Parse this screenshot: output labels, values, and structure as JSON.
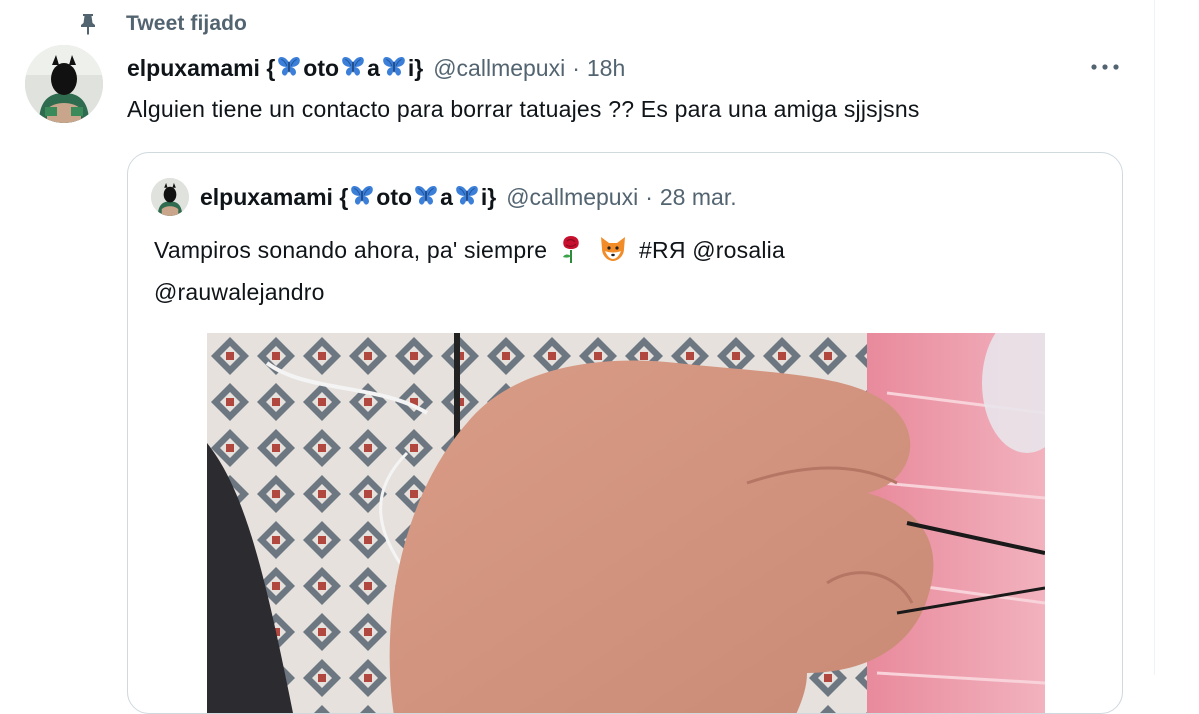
{
  "pinned": {
    "label": "Tweet fijado",
    "icon": "pin-icon"
  },
  "tweet": {
    "author": {
      "name_parts": [
        "elpuxamami {",
        "oto",
        "a",
        "i}"
      ],
      "handle": "@callmepuxi",
      "separator": "·",
      "time": "18h"
    },
    "text": "Alguien tiene un contacto para borrar tatuajes ?? Es para una amiga sjjsjsns",
    "more_icon": "more-options-icon"
  },
  "quoted": {
    "author": {
      "name_parts": [
        "elpuxamami {",
        "oto",
        "a",
        "i}"
      ],
      "handle": "@callmepuxi",
      "separator": "·",
      "time": "28 mar."
    },
    "text": {
      "part1": "Vampiros sonando ahora, pa' siempre",
      "part2": "#RЯ @rosalia",
      "line2": "@rauwalejandro"
    },
    "emojis": [
      "rose-emoji",
      "fox-emoji",
      "butterfly-emoji"
    ],
    "media": "photo-hand"
  },
  "colors": {
    "text": "#0f1419",
    "secondary": "#536471",
    "border": "#cfd9de",
    "butterfly": "#3b7fd9"
  }
}
